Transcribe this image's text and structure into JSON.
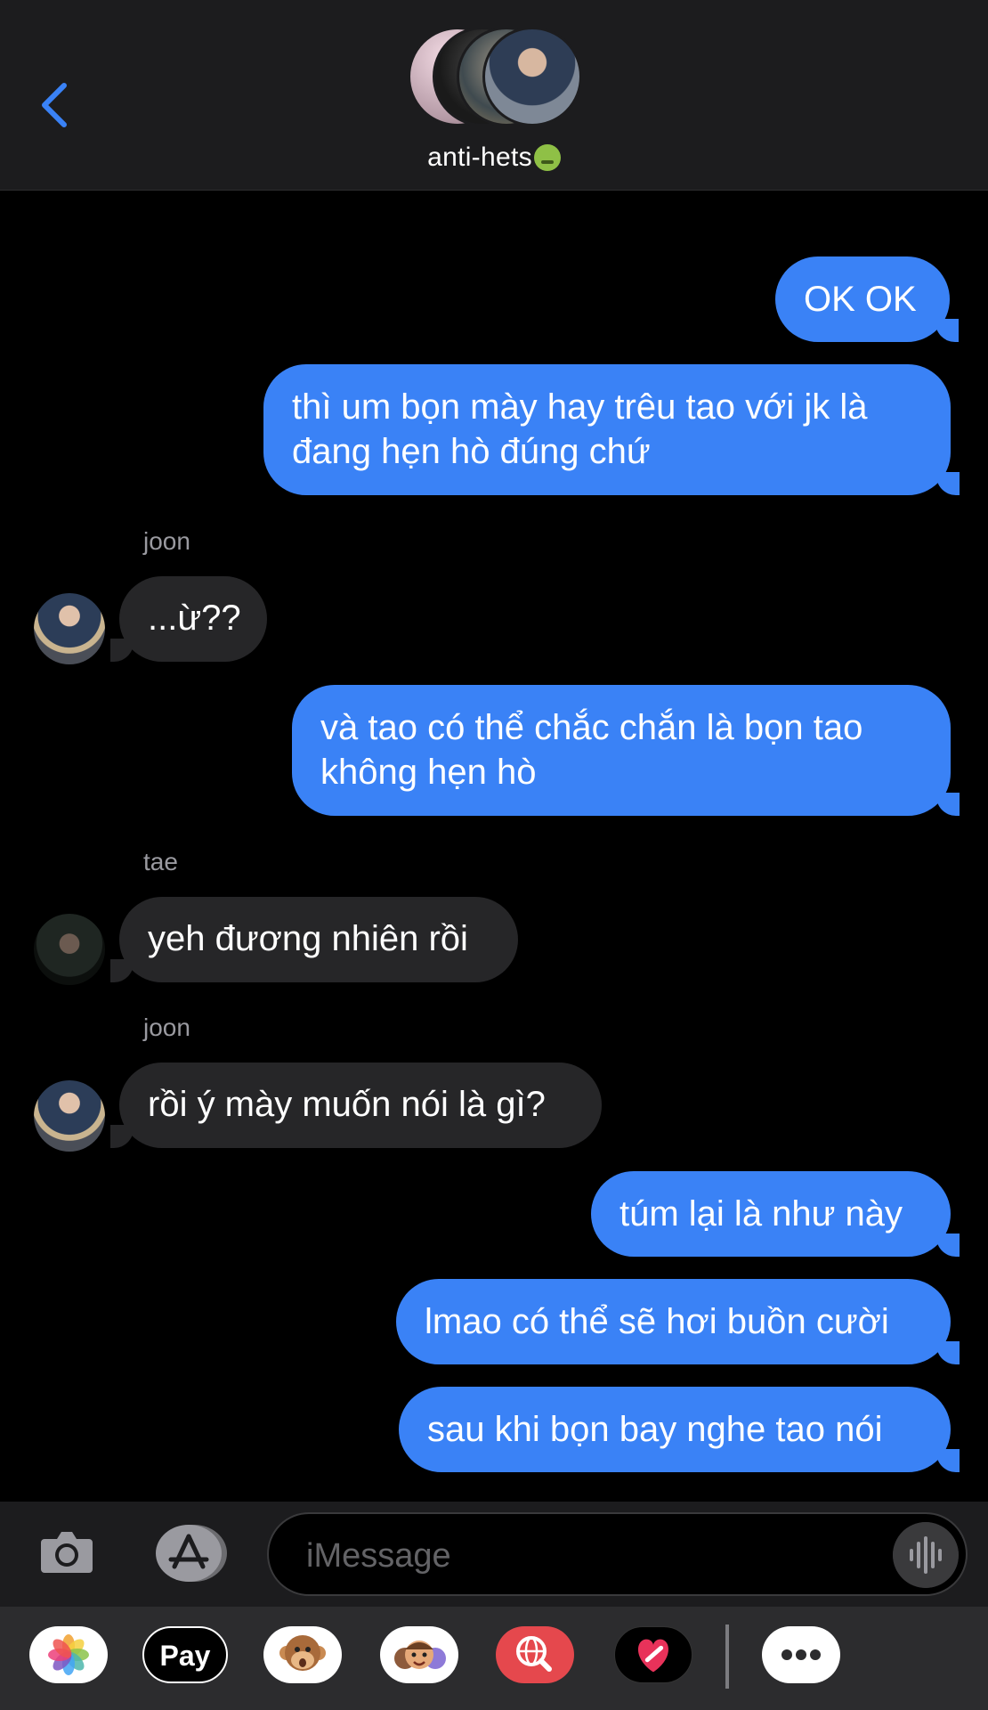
{
  "header": {
    "group_name": "anti-hets",
    "back_icon": "chevron-left-icon",
    "accent_color": "#3a82f6"
  },
  "messages": [
    {
      "direction": "outgoing",
      "text": "OK OK"
    },
    {
      "direction": "outgoing",
      "line1": "thì um bọn mày hay trêu tao với jk là",
      "line2": "đang hẹn hò đúng chứ"
    },
    {
      "direction": "incoming",
      "sender": "joon",
      "text": "...ừ??"
    },
    {
      "direction": "outgoing",
      "line1": "và tao có thể chắc chắn là bọn tao",
      "line2": "không hẹn hò"
    },
    {
      "direction": "incoming",
      "sender": "tae",
      "text": "yeh đương nhiên rồi"
    },
    {
      "direction": "incoming",
      "sender": "joon",
      "text": "rồi ý mày muốn nói là gì?"
    },
    {
      "direction": "outgoing",
      "text": "túm lại là như này"
    },
    {
      "direction": "outgoing",
      "text": "lmao có thể sẽ hơi buồn cười"
    },
    {
      "direction": "outgoing",
      "text": "sau khi bọn bay nghe tao nói"
    }
  ],
  "input": {
    "placeholder": "iMessage",
    "value": ""
  },
  "apps": {
    "pay_label": "Pay",
    "items": [
      "photos-icon",
      "apple-pay-icon",
      "animoji-icon",
      "memoji-icon",
      "image-search-icon",
      "digital-touch-icon",
      "more-icon"
    ]
  },
  "colors": {
    "outgoing_bubble": "#3a82f6",
    "incoming_bubble": "#262628",
    "background": "#000000"
  }
}
